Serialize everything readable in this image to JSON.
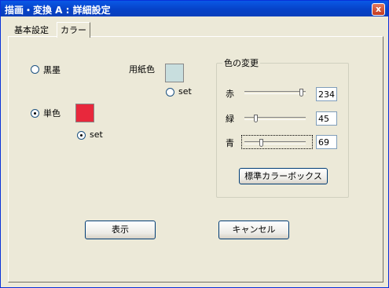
{
  "window": {
    "title": "描画・変換 A : 詳細設定",
    "close_label": "x"
  },
  "tabs": [
    {
      "label": "基本設定",
      "selected": false
    },
    {
      "label": "カラー",
      "selected": true
    }
  ],
  "color_mode": {
    "option_black_label": "黒墨",
    "option_single_label": "単色",
    "selected": "単色",
    "single_color": "#e8283c",
    "single_set_label": "set",
    "single_set_selected": true
  },
  "paper": {
    "label": "用紙色",
    "color": "#c8dede",
    "set_label": "set",
    "set_selected": false
  },
  "color_change": {
    "group_title": "色の変更",
    "sliders": [
      {
        "label": "赤",
        "value": "234",
        "level": 0.918
      },
      {
        "label": "緑",
        "value": "45",
        "level": 0.176
      },
      {
        "label": "青",
        "value": "69",
        "level": 0.271
      }
    ],
    "standard_box_button": "標準カラーボックス"
  },
  "buttons": {
    "show": "表示",
    "cancel": "キャンセル"
  }
}
